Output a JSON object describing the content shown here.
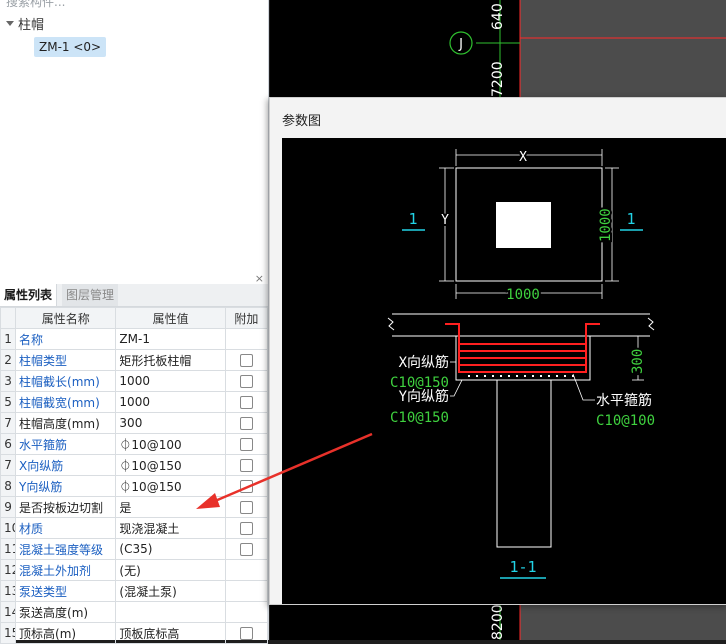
{
  "tree": {
    "search_placeholder": "搜索构件...",
    "category": "柱帽",
    "item": "ZM-1 <0>"
  },
  "props": {
    "close": "×",
    "tabs": [
      "属性列表",
      "图层管理"
    ],
    "headers": [
      "属性名称",
      "属性值",
      "附加"
    ],
    "rows": [
      {
        "no": "1",
        "name": "名称",
        "value": "ZM-1",
        "blue": true,
        "check": false
      },
      {
        "no": "2",
        "name": "柱帽类型",
        "value": "矩形托板柱帽",
        "blue": true,
        "check": true
      },
      {
        "no": "3",
        "name": "柱帽截长(mm)",
        "value": "1000",
        "blue": true,
        "check": true
      },
      {
        "no": "5",
        "name": "柱帽截宽(mm)",
        "value": "1000",
        "blue": true,
        "check": true
      },
      {
        "no": "7",
        "name": "柱帽高度(mm)",
        "value": "300",
        "blue": false,
        "check": true
      },
      {
        "no": "6",
        "name": "水平箍筋",
        "value": "⏀10@100",
        "blue": true,
        "check": true
      },
      {
        "no": "7",
        "name": "X向纵筋",
        "value": "⏀10@150",
        "blue": true,
        "check": true
      },
      {
        "no": "8",
        "name": "Y向纵筋",
        "value": "⏀10@150",
        "blue": true,
        "check": true
      },
      {
        "no": "9",
        "name": "是否按板边切割",
        "value": "是",
        "blue": false,
        "check": true
      },
      {
        "no": "10",
        "name": "材质",
        "value": "现浇混凝土",
        "blue": true,
        "check": true
      },
      {
        "no": "11",
        "name": "混凝土强度等级",
        "value": "(C35)",
        "blue": true,
        "check": true
      },
      {
        "no": "12",
        "name": "混凝土外加剂",
        "value": "(无)",
        "blue": true,
        "check": false
      },
      {
        "no": "13",
        "name": "泵送类型",
        "value": "(混凝土泵)",
        "blue": true,
        "check": false
      },
      {
        "no": "14",
        "name": "泵送高度(m)",
        "value": "",
        "blue": false,
        "check": false
      },
      {
        "no": "15",
        "name": "顶标高(m)",
        "value": "顶板底标高",
        "blue": false,
        "check": true
      }
    ]
  },
  "cad": {
    "dim_top": "640",
    "axis_label": "J",
    "dim_mid": "7200",
    "dim_bottom": "8200"
  },
  "dialog": {
    "title": "参数图",
    "plan": {
      "x_label": "X",
      "y_label": "Y",
      "width_dim": "1000",
      "height_dim": "1000",
      "section_mark_left": "1",
      "section_mark_right": "1"
    },
    "section": {
      "x_rebar_label": "X向纵筋",
      "x_rebar_spec": "C10@150",
      "y_rebar_label": "Y向纵筋",
      "y_rebar_spec": "C10@150",
      "stirrup_label": "水平箍筋",
      "stirrup_spec": "C10@100",
      "depth_dim": "300",
      "section_title": "1-1"
    }
  },
  "colors": {
    "accent_blue": "#1b5fc1",
    "cad_green": "#3fd13f",
    "cad_red": "#ff2020",
    "cad_cyan": "#22d3e6",
    "arrow_red": "#e8312a"
  }
}
